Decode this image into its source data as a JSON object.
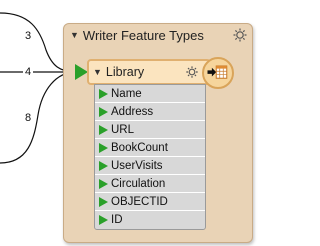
{
  "connections": [
    {
      "label": "3"
    },
    {
      "label": "4"
    },
    {
      "label": "8"
    }
  ],
  "panel": {
    "title": "Writer Feature Types",
    "icon": "gear-icon"
  },
  "feature_type": {
    "name": "Library",
    "gear_icon": "gear-icon",
    "writer_icon": "table-writer-icon"
  },
  "attributes": [
    "Name",
    "Address",
    "URL",
    "BookCount",
    "UserVisits",
    "Circulation",
    "OBJECTID",
    "ID"
  ],
  "colors": {
    "port": "#2aa02a",
    "panel_bg": "#e9d3b6",
    "node_bg": "#fbe4bf",
    "attr_bg": "#d8d8d8"
  }
}
